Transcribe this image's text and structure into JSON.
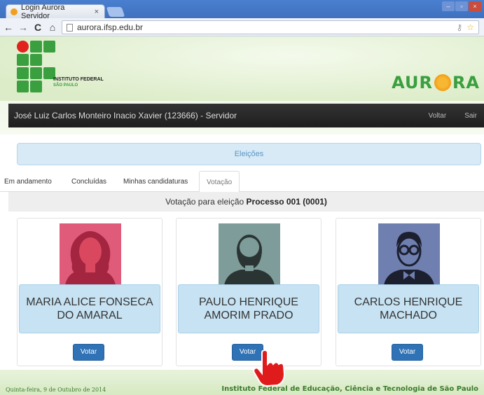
{
  "browser": {
    "tab_title": "Login Aurora Servidor",
    "tab_close": "×",
    "url": "aurora.ifsp.edu.br",
    "window_controls": [
      "–",
      "▫",
      "×"
    ]
  },
  "header": {
    "institution_name": "INSTITUTO FEDERAL",
    "institution_sub": "SÃO PAULO",
    "app_logo": "AUR RA"
  },
  "userbar": {
    "user": "José Luiz Carlos Monteiro Inacio Xavier (123666) - Servidor",
    "links": [
      "Voltar",
      "Sair"
    ]
  },
  "section": {
    "title": "Eleições"
  },
  "tabs": [
    "Em andamento",
    "Concluídas",
    "Minhas candidaturas",
    "Votação"
  ],
  "vote_header": {
    "prefix": "Votação para eleição",
    "process": "Processo 001 (0001)"
  },
  "candidates": [
    {
      "name": "MARIA ALICE FONSECA DO AMARAL",
      "button": "Votar",
      "avatar_icon": "female-avatar-icon",
      "avatar_bg": "#e05a7a"
    },
    {
      "name": "PAULO HENRIQUE AMORIM PRADO",
      "button": "Votar",
      "avatar_icon": "male-beard-avatar-icon",
      "avatar_bg": "#7e9c9a"
    },
    {
      "name": "CARLOS HENRIQUE MACHADO",
      "button": "Votar",
      "avatar_icon": "male-glasses-avatar-icon",
      "avatar_bg": "#6f7fb0"
    }
  ],
  "footer": {
    "date": "Quinta-feira, 9 de Outubro de 2014",
    "institution": "Instituto Federal de Educação, Ciência e Tecnologia de São Paulo"
  },
  "colors": {
    "primary_button": "#2f72b6",
    "brand_green": "#3a9f3f",
    "header_dark": "#222222"
  }
}
